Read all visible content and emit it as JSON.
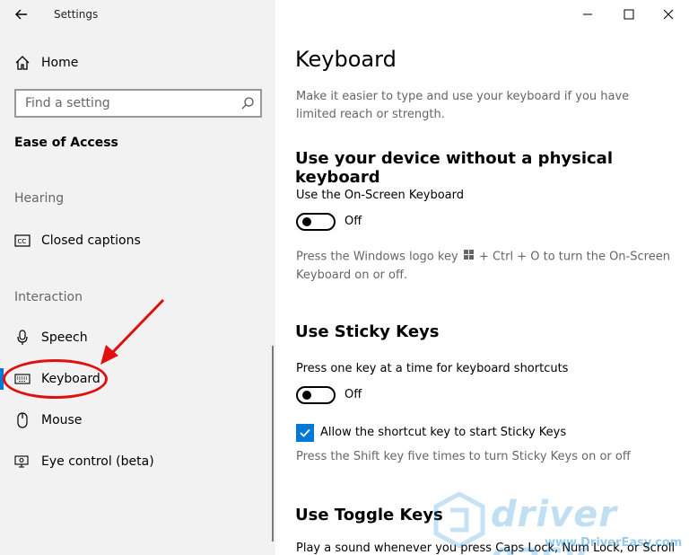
{
  "window": {
    "app_title": "Settings",
    "minimize_icon": "minimize-icon",
    "maximize_icon": "maximize-icon",
    "close_icon": "close-icon"
  },
  "sidebar": {
    "home_label": "Home",
    "search_placeholder": "Find a setting",
    "section_title": "Ease of Access",
    "groups": {
      "hearing": "Hearing",
      "interaction": "Interaction"
    },
    "items": {
      "closed_captions": "Closed captions",
      "speech": "Speech",
      "keyboard": "Keyboard",
      "mouse": "Mouse",
      "eye_control": "Eye control (beta)"
    },
    "active_item": "keyboard"
  },
  "main": {
    "title": "Keyboard",
    "intro": "Make it easier to type and use your keyboard if you have limited reach or strength.",
    "sections": {
      "onscreen": {
        "heading": "Use your device without a physical keyboard",
        "label": "Use the On-Screen Keyboard",
        "state": "Off",
        "help_part1": "Press the Windows logo key",
        "help_part2": "+ Ctrl + O to turn the On-Screen Keyboard on or off."
      },
      "sticky": {
        "heading": "Use Sticky Keys",
        "label": "Press one key at a time for keyboard shortcuts",
        "state": "Off",
        "checkbox_label": "Allow the shortcut key to start Sticky Keys",
        "checkbox_checked": true,
        "help": "Press the Shift key five times to turn Sticky Keys on or off"
      },
      "toggle": {
        "heading": "Use Toggle Keys",
        "label": "Play a sound whenever you press Caps Lock, Num Lock, or Scroll"
      }
    }
  },
  "watermark": {
    "brand": "driver easy",
    "url": "www.DriverEasy.com"
  },
  "colors": {
    "accent": "#0078d7",
    "annotation_red": "#e01010",
    "sidebar_bg": "#f2f2f2"
  }
}
